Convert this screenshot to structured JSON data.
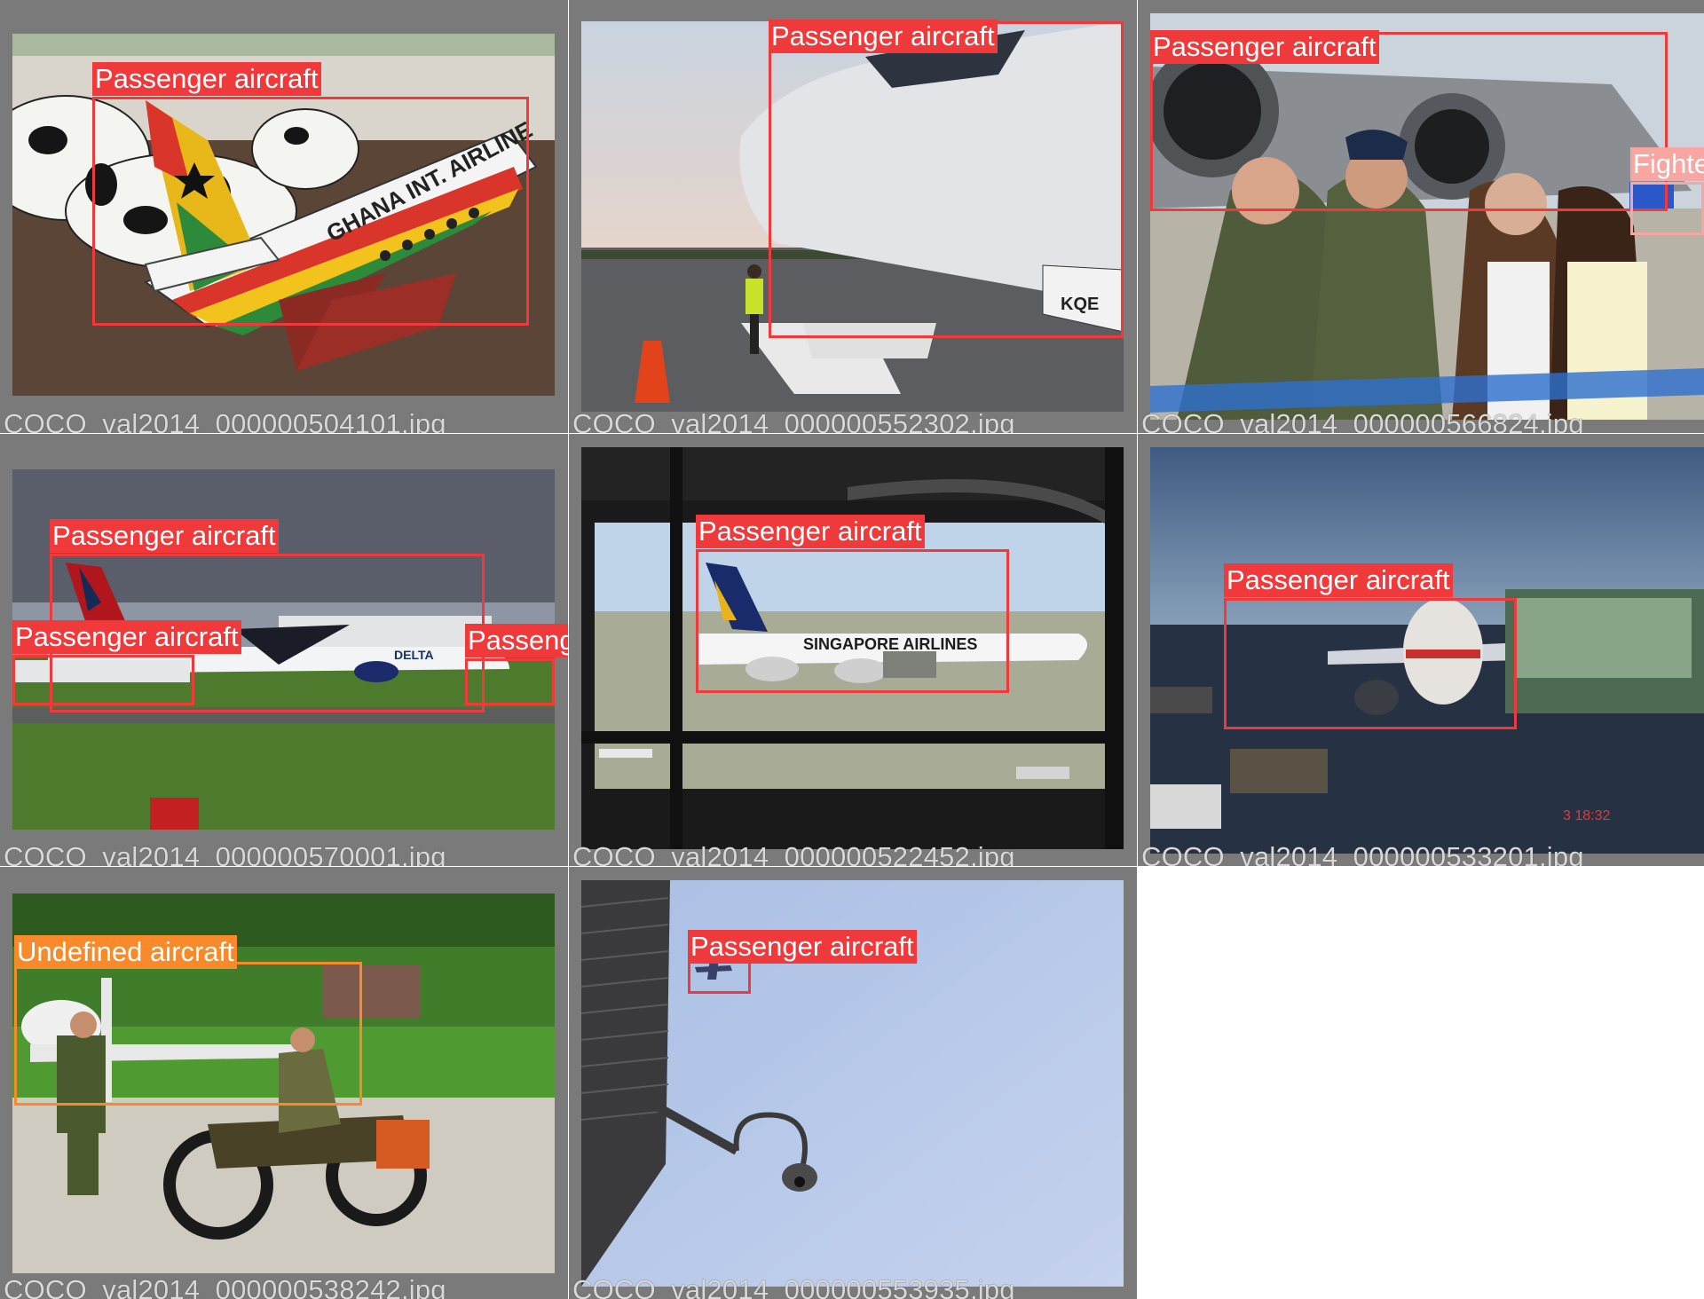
{
  "tiles": [
    {
      "filename": "COCO_val2014_000000504101.jpg",
      "detections": [
        {
          "label": "Passenger aircraft",
          "color": "#f0393a"
        }
      ]
    },
    {
      "filename": "COCO_val2014_000000552302.jpg",
      "detections": [
        {
          "label": "Passenger aircraft",
          "color": "#f0393a"
        }
      ]
    },
    {
      "filename": "COCO_val2014_000000566824.jpg",
      "detections": [
        {
          "label": "Passenger aircraft",
          "color": "#f0393a"
        },
        {
          "label": "Fighte",
          "color": "#f7a6a1"
        }
      ]
    },
    {
      "filename": "COCO_val2014_000000570001.jpg",
      "detections": [
        {
          "label": "Passenger aircraft",
          "color": "#f0393a"
        },
        {
          "label": "Passenger aircraft",
          "color": "#f0393a"
        },
        {
          "label": "Passenger aircraf",
          "color": "#f0393a"
        }
      ]
    },
    {
      "filename": "COCO_val2014_000000522452.jpg",
      "detections": [
        {
          "label": "Passenger aircraft",
          "color": "#f0393a"
        }
      ]
    },
    {
      "filename": "COCO_val2014_000000533201.jpg",
      "detections": [
        {
          "label": "Passenger aircraft",
          "color": "#f0393a"
        }
      ]
    },
    {
      "filename": "COCO_val2014_000000538242.jpg",
      "detections": [
        {
          "label": "Undefined aircraft",
          "color": "#f88a2c"
        }
      ]
    },
    {
      "filename": "COCO_val2014_000000553935.jpg",
      "detections": [
        {
          "label": "Passenger aircraft",
          "color": "#f0393a"
        }
      ]
    }
  ],
  "photo_texts": {
    "airline_ghana": "GHANA INT. AIRLINE",
    "tail_kqe": "KQE",
    "delta": "DELTA",
    "singapore": "SINGAPORE AIRLINES",
    "timestamp": "3 18:32"
  }
}
